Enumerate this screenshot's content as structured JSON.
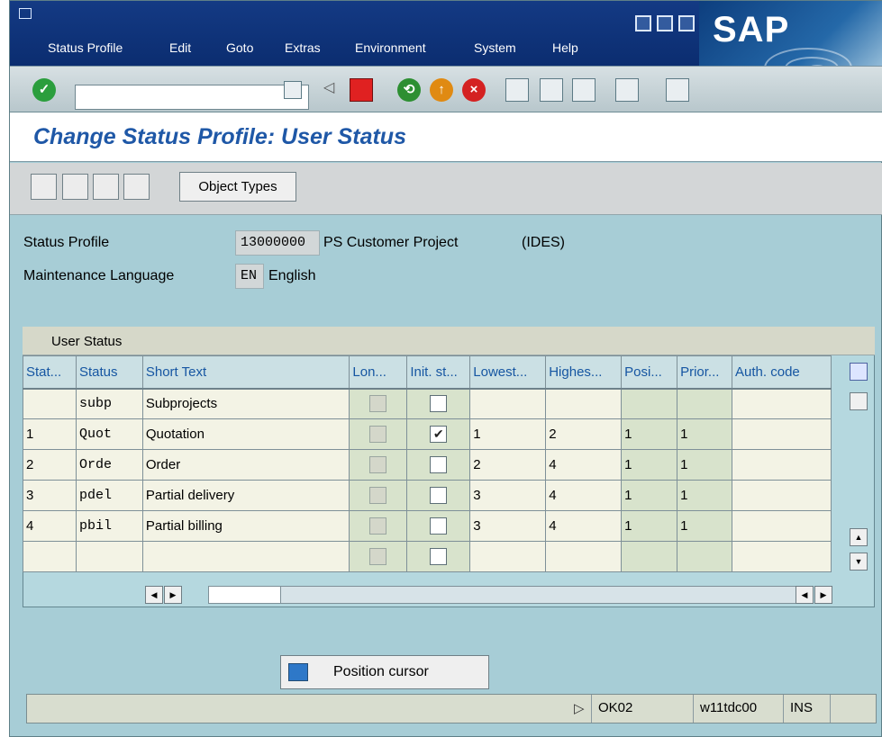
{
  "window": {
    "title": "Change Status Profile: User Status"
  },
  "menu": [
    "Status Profile",
    "Edit",
    "Goto",
    "Extras",
    "Environment",
    "System",
    "Help"
  ],
  "toolbar": {
    "command_value": "",
    "logo": "SAP"
  },
  "app_toolbar": {
    "object_types_label": "Object Types"
  },
  "header": {
    "status_profile_label": "Status Profile",
    "status_profile_code": "13000000",
    "status_profile_text": "PS Customer Project",
    "status_profile_extra": "(IDES)",
    "language_label": "Maintenance Language",
    "language_code": "EN",
    "language_text": "English"
  },
  "table": {
    "title": "User Status",
    "columns": [
      "Stat...",
      "Status",
      "Short Text",
      "Lon...",
      "Init. st...",
      "Lowest...",
      "Highes...",
      "Posi...",
      "Prior...",
      "Auth. code"
    ],
    "rows": [
      {
        "stat": "",
        "status": "subp",
        "short": "Subprojects",
        "lon": false,
        "init": false,
        "lowest": "",
        "highest": "",
        "posi": "",
        "prior": "",
        "auth": ""
      },
      {
        "stat": "1",
        "status": "Quot",
        "short": "Quotation",
        "lon": false,
        "init": true,
        "lowest": "1",
        "highest": "2",
        "posi": "1",
        "prior": "1",
        "auth": ""
      },
      {
        "stat": "2",
        "status": "Orde",
        "short": "Order",
        "lon": false,
        "init": false,
        "lowest": "2",
        "highest": "4",
        "posi": "1",
        "prior": "1",
        "auth": ""
      },
      {
        "stat": "3",
        "status": "pdel",
        "short": "Partial delivery",
        "lon": false,
        "init": false,
        "lowest": "3",
        "highest": "4",
        "posi": "1",
        "prior": "1",
        "auth": ""
      },
      {
        "stat": "4",
        "status": "pbil",
        "short": "Partial billing",
        "lon": false,
        "init": false,
        "lowest": "3",
        "highest": "4",
        "posi": "1",
        "prior": "1",
        "auth": ""
      },
      {
        "stat": "",
        "status": "",
        "short": "",
        "lon": false,
        "init": false,
        "lowest": "",
        "highest": "",
        "posi": "",
        "prior": "",
        "auth": ""
      }
    ]
  },
  "buttons": {
    "position_cursor": "Position cursor"
  },
  "statusbar": {
    "transaction": "OK02",
    "system": "w11tdc00",
    "mode": "INS"
  }
}
